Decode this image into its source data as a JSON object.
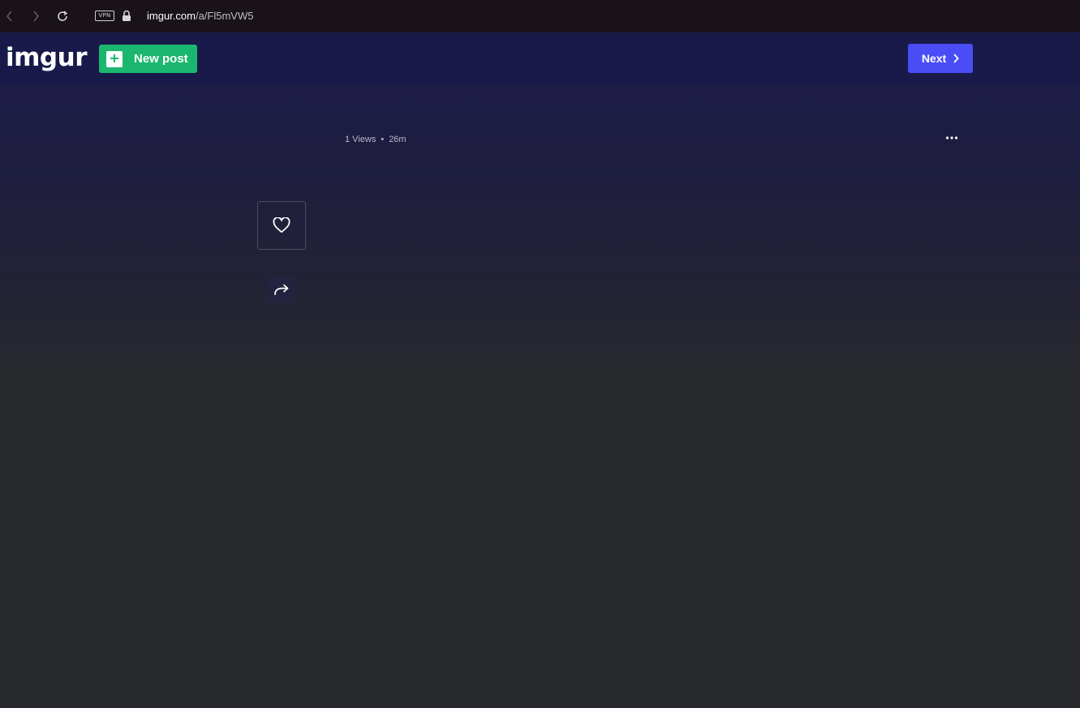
{
  "browser": {
    "url_host": "imgur.com",
    "url_path": "/a/Fl5mVW5",
    "vpn_label": "VPN"
  },
  "header": {
    "logo": "imgur",
    "new_post_label": "New post",
    "next_label": "Next"
  },
  "post": {
    "views": "1 Views",
    "separator": "•",
    "age": "26m"
  },
  "colors": {
    "accent_green": "#1bb76e",
    "accent_blue": "#4a4cf5",
    "nav_bg": "#191a4a",
    "page_bg": "#27292d"
  },
  "icons": {
    "back": "chevron-left-icon",
    "forward": "chevron-right-icon",
    "reload": "reload-icon",
    "lock": "lock-icon",
    "more": "ellipsis-icon",
    "like": "heart-icon",
    "share": "share-arrow-icon"
  }
}
